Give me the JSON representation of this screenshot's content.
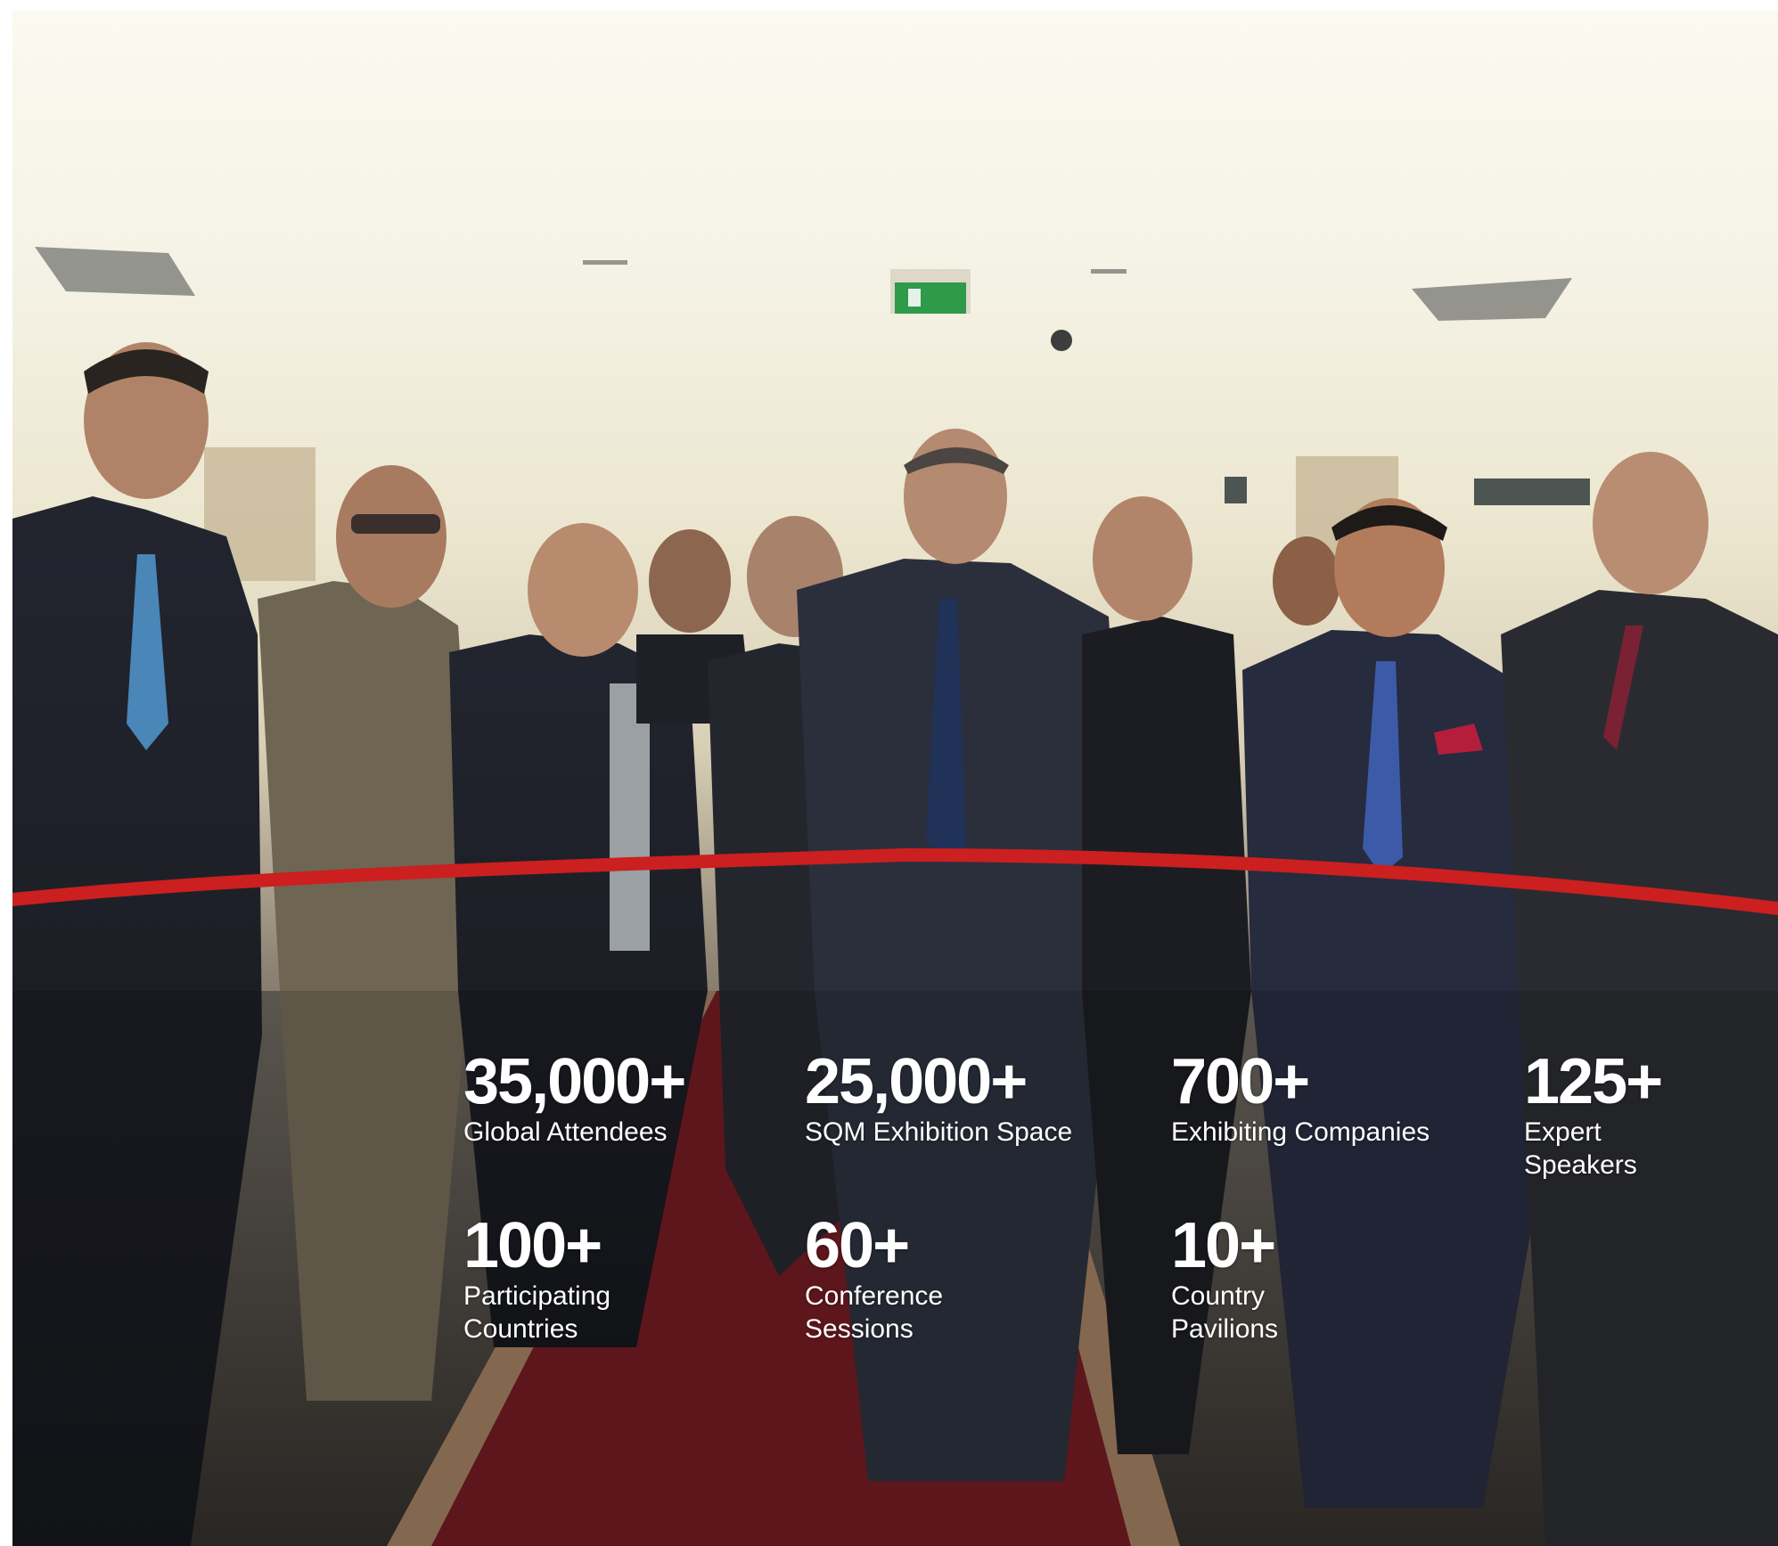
{
  "photo": {
    "subject": "ribbon-cutting-ceremony",
    "ribbon_color": "#cc1f1f",
    "carpet_color": "#6e1b22",
    "exit_sign_color": "#2f9a4a"
  },
  "stats": [
    {
      "value": "35,000+",
      "label": "Global Attendees"
    },
    {
      "value": "25,000+",
      "label": "SQM Exhibition Space"
    },
    {
      "value": "700+",
      "label": "Exhibiting Companies"
    },
    {
      "value": "125+",
      "label": "Expert\nSpeakers"
    },
    {
      "value": "100+",
      "label": "Participating\nCountries"
    },
    {
      "value": "60+",
      "label": "Conference\nSessions"
    },
    {
      "value": "10+",
      "label": "Country\nPavilions"
    }
  ]
}
